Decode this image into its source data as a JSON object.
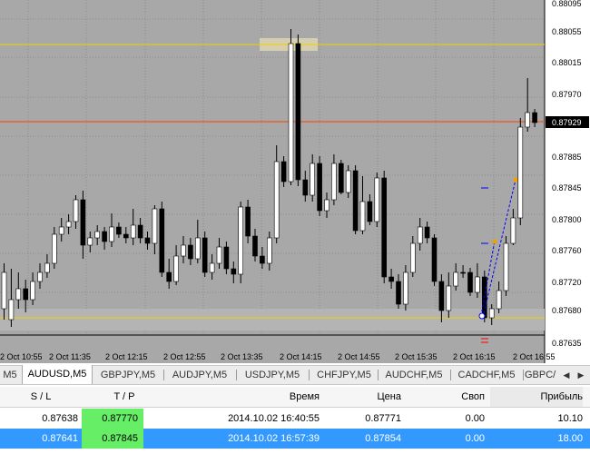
{
  "chart": {
    "price_axis": [
      "0.88095",
      "0.88055",
      "0.88015",
      "0.87970",
      "0.87929",
      "0.87885",
      "0.87845",
      "0.87800",
      "0.87760",
      "0.87720",
      "0.87680",
      "0.87635"
    ],
    "current_price": "0.87929",
    "time_axis": [
      "2 Oct 10:55",
      "2 Oct 11:35",
      "2 Oct 12:15",
      "2 Oct 12:55",
      "2 Oct 13:35",
      "2 Oct 14:15",
      "2 Oct 14:55",
      "2 Oct 15:35",
      "2 Oct 16:15",
      "2 Oct 16:55"
    ],
    "colors": {
      "background": "#a8a8a8",
      "grid": "#8c8c8c",
      "bull": "#ffffff",
      "bear": "#000000",
      "level_line": "#f0d000",
      "bid_line": "#ff4000",
      "trade_line": "#0000ff"
    }
  },
  "tabs": {
    "items": [
      "M5",
      "AUDUSD,M5",
      "GBPJPY,M5",
      "AUDJPY,M5",
      "USDJPY,M5",
      "CHFJPY,M5",
      "AUDCHF,M5",
      "CADCHF,M5",
      "GBPC/"
    ],
    "active_index": 1,
    "prev_icon": "triangle-left-icon",
    "next_icon": "triangle-right-icon"
  },
  "positions": {
    "headers": {
      "sl": "S / L",
      "tp": "T / P",
      "time": "Время",
      "price": "Цена",
      "swap": "Своп",
      "profit": "Прибыль"
    },
    "rows": [
      {
        "sl": "0.87638",
        "tp": "0.87770",
        "time": "2014.10.02 16:40:55",
        "price": "0.87771",
        "swap": "0.00",
        "profit": "10.10"
      },
      {
        "sl": "0.87641",
        "tp": "0.87845",
        "time": "2014.10.02 16:57:39",
        "price": "0.87854",
        "swap": "0.00",
        "profit": "18.00"
      }
    ],
    "selected_row": 1,
    "highlight_color": "#66ee66",
    "selection_color": "#3399ff"
  }
}
